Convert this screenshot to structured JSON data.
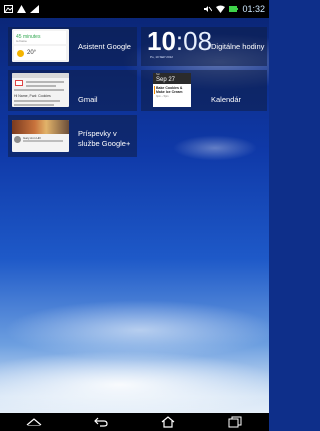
{
  "statusbar": {
    "time": "01:32",
    "left_icons": [
      "gallery-icon",
      "warning-icon",
      "signal-edit-icon"
    ],
    "right_icons": [
      "no-sound-icon",
      "wifi-icon",
      "battery-icon"
    ]
  },
  "widgets": [
    {
      "id": "google-now",
      "label": "Asistent Google",
      "preview": {
        "headline": "45 minutes",
        "subline": "to home",
        "temp": "20°"
      }
    },
    {
      "id": "digital-clock",
      "label": "Digitálne hodiny",
      "preview": {
        "hour": "10",
        "minute": "08",
        "date": "Po, 10 SEP 2012"
      }
    },
    {
      "id": "gmail",
      "label": "Gmail",
      "preview": {
        "subject": "Hi Name, Fwd: Cookies"
      }
    },
    {
      "id": "calendar",
      "label": "Kalendár",
      "preview": {
        "dow": "Sat",
        "day": "Sep 27",
        "event_line1": "Bake Cookies &",
        "event_line2": "Make Ice Cream",
        "event_time": "3pm – 5pm"
      }
    },
    {
      "id": "google-plus",
      "label": "Príspevky v službe Google+",
      "preview": {
        "author": "Gary Ann Hill"
      }
    }
  ],
  "navbar": {
    "buttons": [
      "home-up-icon",
      "back-icon",
      "home-icon",
      "recents-icon"
    ]
  },
  "colors": {
    "statusbar_bg": "#000000",
    "tile_bg": "rgba(15,30,70,0.55)",
    "google_now_green": "#33a852",
    "calendar_accent": "#f28b00"
  }
}
